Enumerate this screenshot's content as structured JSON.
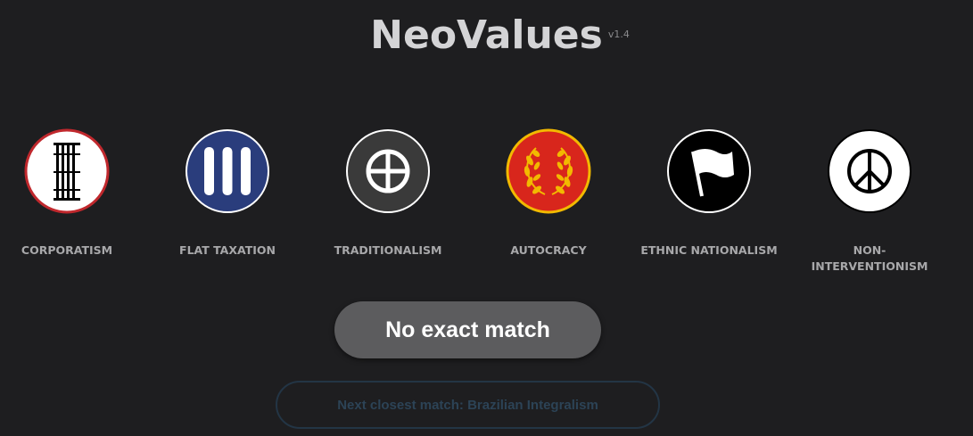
{
  "header": {
    "title": "NeoValues",
    "version": "v1.4"
  },
  "values": [
    {
      "label": "CORPORATISM",
      "icon": "fasces-icon",
      "bg": "#ffffff",
      "ring": "#c0282d"
    },
    {
      "label": "FLAT TAXATION",
      "icon": "three-bars-icon",
      "bg": "#2a3d7c",
      "ring": "#ffffff"
    },
    {
      "label": "TRADITIONALISM",
      "icon": "sun-cross-icon",
      "bg": "#3a3a3a",
      "ring": "#ffffff"
    },
    {
      "label": "AUTOCRACY",
      "icon": "laurel-wreath-icon",
      "bg": "#d8261c",
      "ring": "#f2b900"
    },
    {
      "label": "ETHNIC NATIONALISM",
      "icon": "flag-icon",
      "bg": "#000000",
      "ring": "#ffffff"
    },
    {
      "label": "NON-INTERVENTIONISM",
      "icon": "peace-icon",
      "bg": "#ffffff",
      "ring": "#000000"
    }
  ],
  "result": {
    "match_label": "No exact match",
    "next_label": "Next closest match: Brazilian Integralism"
  },
  "colors": {
    "background": "#1e1e20",
    "button": "#5c5c5e",
    "next_border": "#233545",
    "next_text": "#2c4356"
  }
}
